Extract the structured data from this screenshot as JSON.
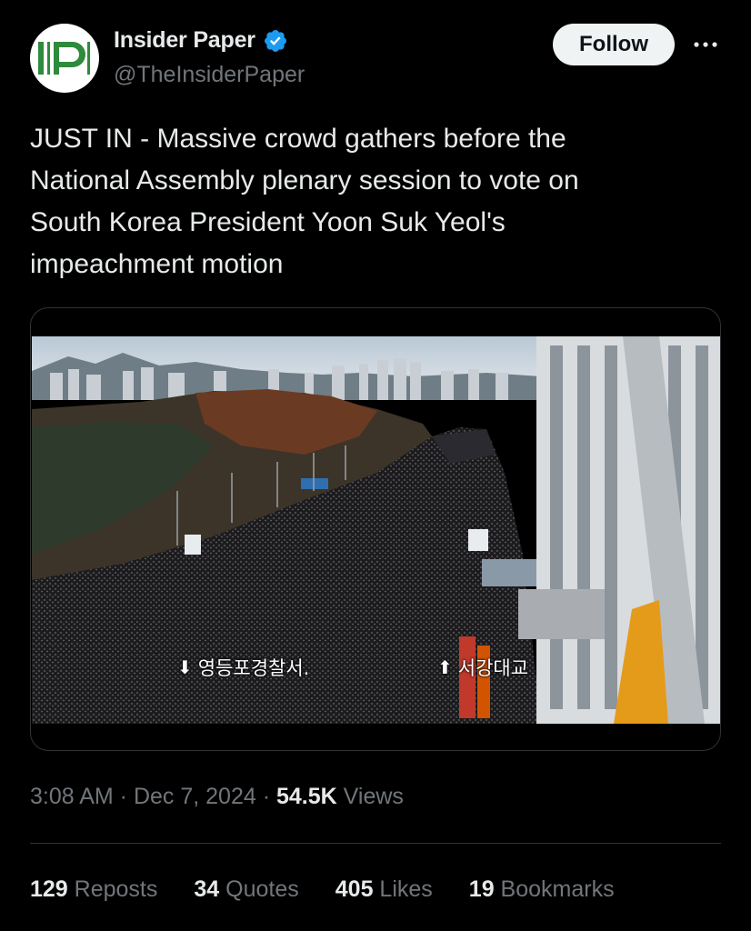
{
  "author": {
    "display_name": "Insider Paper",
    "handle": "@TheInsiderPaper",
    "avatar_text": "IP",
    "verified": true
  },
  "actions": {
    "follow_label": "Follow",
    "more_icon": "more-horizontal-icon"
  },
  "tweet": {
    "text": "JUST IN - Massive crowd gathers before the\nNational Assembly plenary session to vote on\nSouth Korea President Yoon Suk Yeol's\nimpeachment motion"
  },
  "media": {
    "sign_left_text": "영등포경찰서.",
    "sign_right_text": "서강대교"
  },
  "meta": {
    "time": "3:08 AM",
    "separator": " · ",
    "date": "Dec 7, 2024",
    "views_count": "54.5K",
    "views_label": " Views"
  },
  "stats": [
    {
      "count": "129",
      "label": " Reposts"
    },
    {
      "count": "34",
      "label": " Quotes"
    },
    {
      "count": "405",
      "label": " Likes"
    },
    {
      "count": "19",
      "label": " Bookmarks"
    }
  ],
  "colors": {
    "background": "#000000",
    "text_primary": "#e7e9ea",
    "text_secondary": "#71767b",
    "verified_blue": "#1d9bf0",
    "avatar_green": "#2e8a3c",
    "follow_bg": "#eff3f4"
  }
}
